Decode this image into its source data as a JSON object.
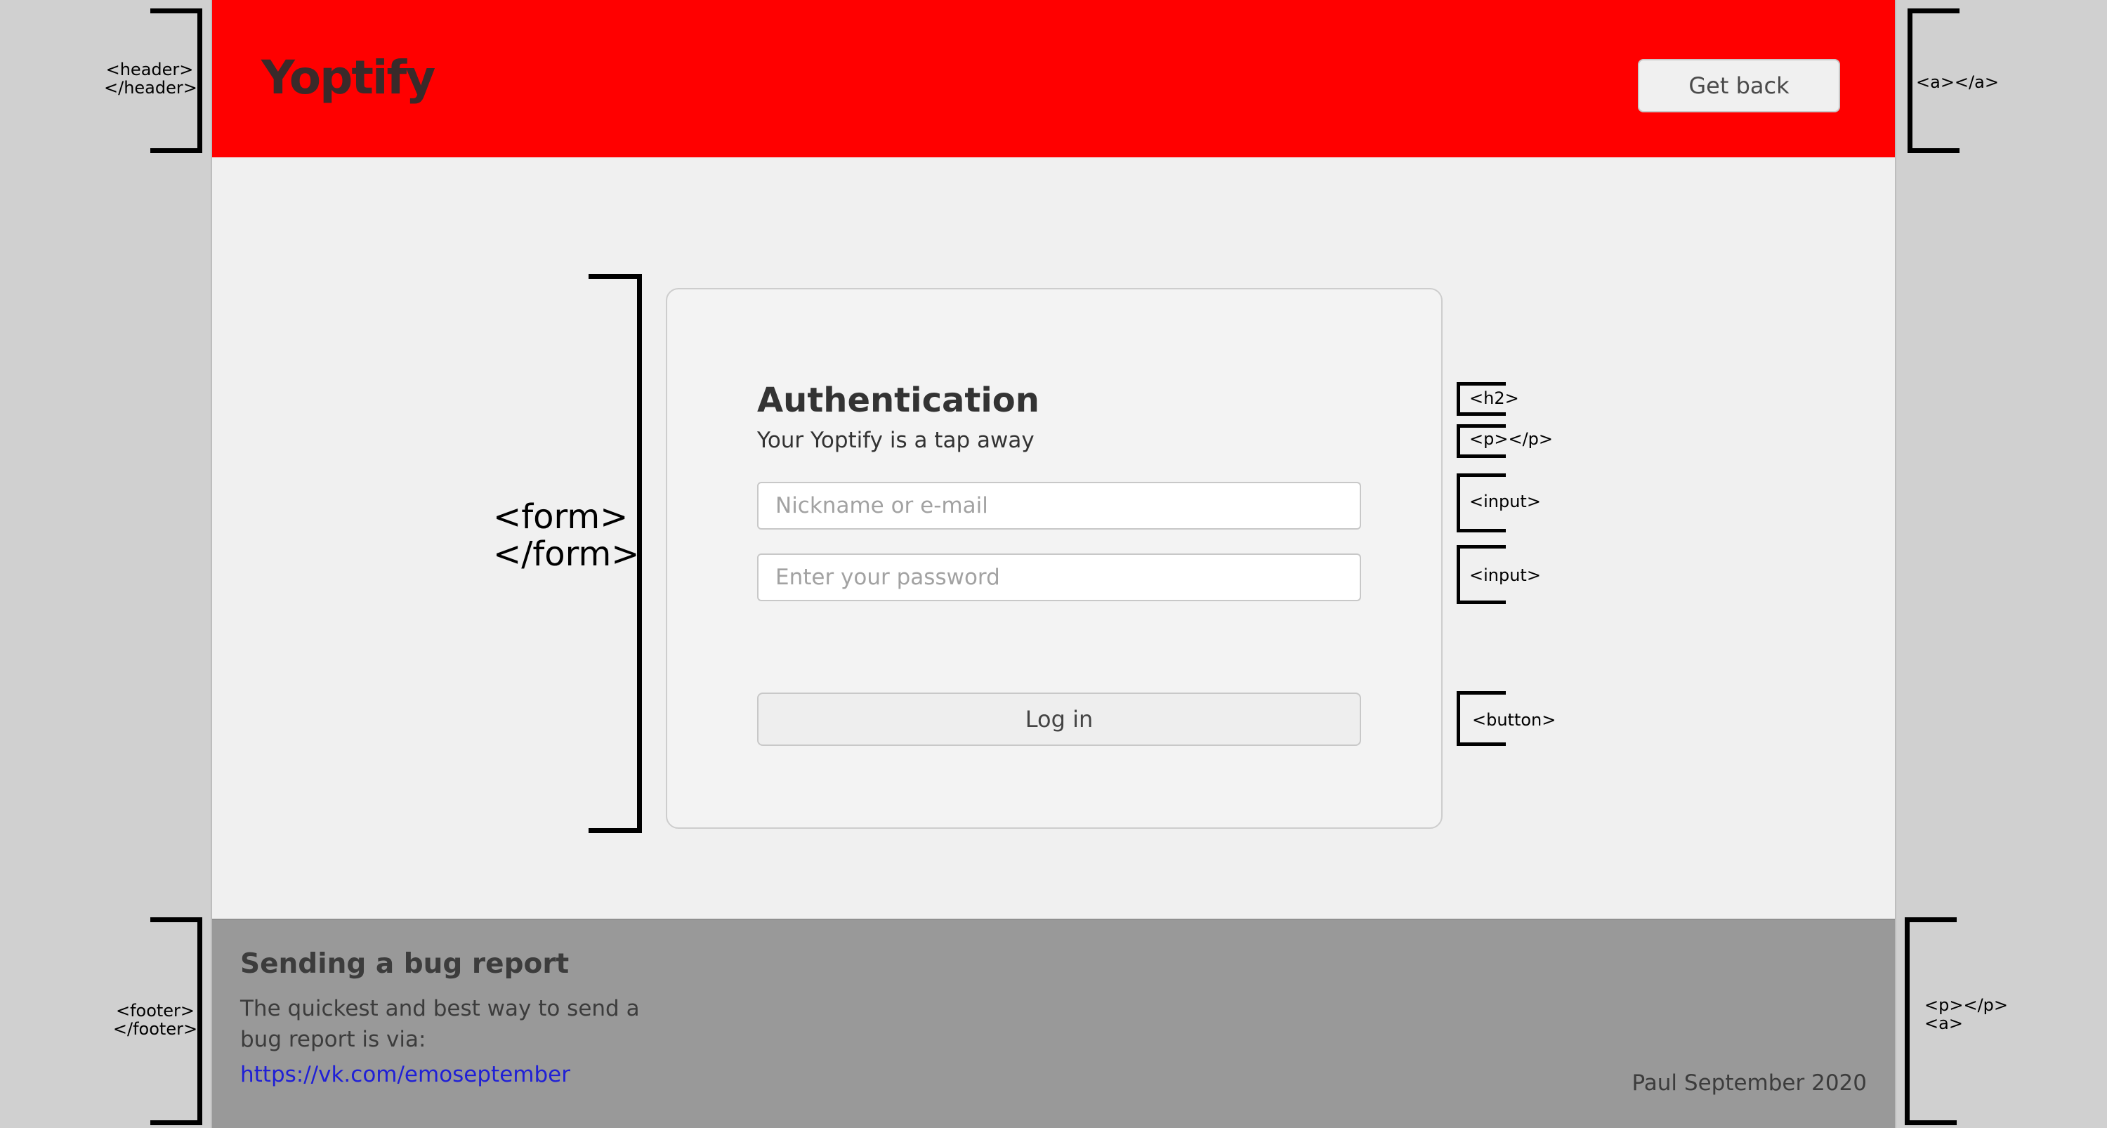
{
  "header": {
    "logo": "Yoptify",
    "back_link_label": "Get back"
  },
  "form": {
    "title": "Authentication",
    "subtitle": "Your Yoptify is a tap away",
    "nickname_placeholder": "Nickname or e-mail",
    "password_placeholder": "Enter your password",
    "login_label": "Log in"
  },
  "footer": {
    "title": "Sending a bug report",
    "description": "The quickest and best way to send a bug report is via:",
    "link": "https://vk.com/emoseptember",
    "credit": "Paul September 2020"
  },
  "annotations": {
    "header": "<header>\n</header>",
    "anchor": "<a></a>",
    "form": "<form>\n</form>",
    "h2": "<h2>",
    "p": "<p></p>",
    "input1": "<input>",
    "input2": "<input>",
    "button": "<button>",
    "footer": "<footer>\n</footer>",
    "footer_right": "<p></p>\n<a>"
  },
  "colors": {
    "header_bg": "#ff0000",
    "page_bg": "#f0f0f0",
    "footer_bg": "#999999",
    "link": "#1f1fd6"
  }
}
